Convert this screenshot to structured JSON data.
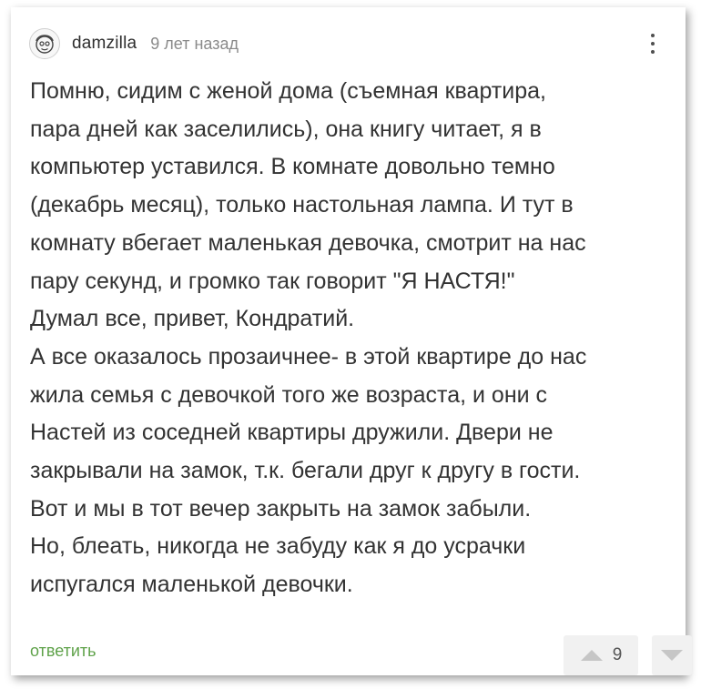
{
  "comment": {
    "author": "damzilla",
    "time": "9 лет назад",
    "lines": [
      "Помню, сидим с женой дома (съемная квартира,",
      "пара дней как заселились), она книгу читает, я в",
      "компьютер уставился. В комнате довольно темно",
      "(декабрь месяц), только настольная лампа. И тут в",
      "комнату вбегает маленькая девочка, смотрит на нас",
      "пару секунд, и громко так говорит \"Я НАСТЯ!\"",
      "Думал все, привет, Кондратий.",
      "А все оказалось прозаичнее- в этой квартире до нас",
      "жила семья с девочкой того же возраста, и они с",
      "Настей из соседней квартиры дружили. Двери не",
      "закрывали на замок, т.к. бегали друг к другу в гости.",
      "Вот и мы в тот вечер закрыть на замок забыли.",
      "Но, блеать, никогда не забуду как я до усрачки",
      "испугался маленькой девочки."
    ]
  },
  "actions": {
    "reply_label": "ответить",
    "vote_count": "9"
  },
  "icons": {
    "avatar": "avatar-face-icon",
    "menu": "more-vertical-icon",
    "upvote": "triangle-up-icon",
    "downvote": "triangle-down-icon"
  },
  "colors": {
    "reply": "#5fa24a",
    "text": "#333333",
    "meta": "#8a8a8a",
    "vote_bg": "#f1f1f1",
    "vote_icon": "#c6c6c6"
  }
}
